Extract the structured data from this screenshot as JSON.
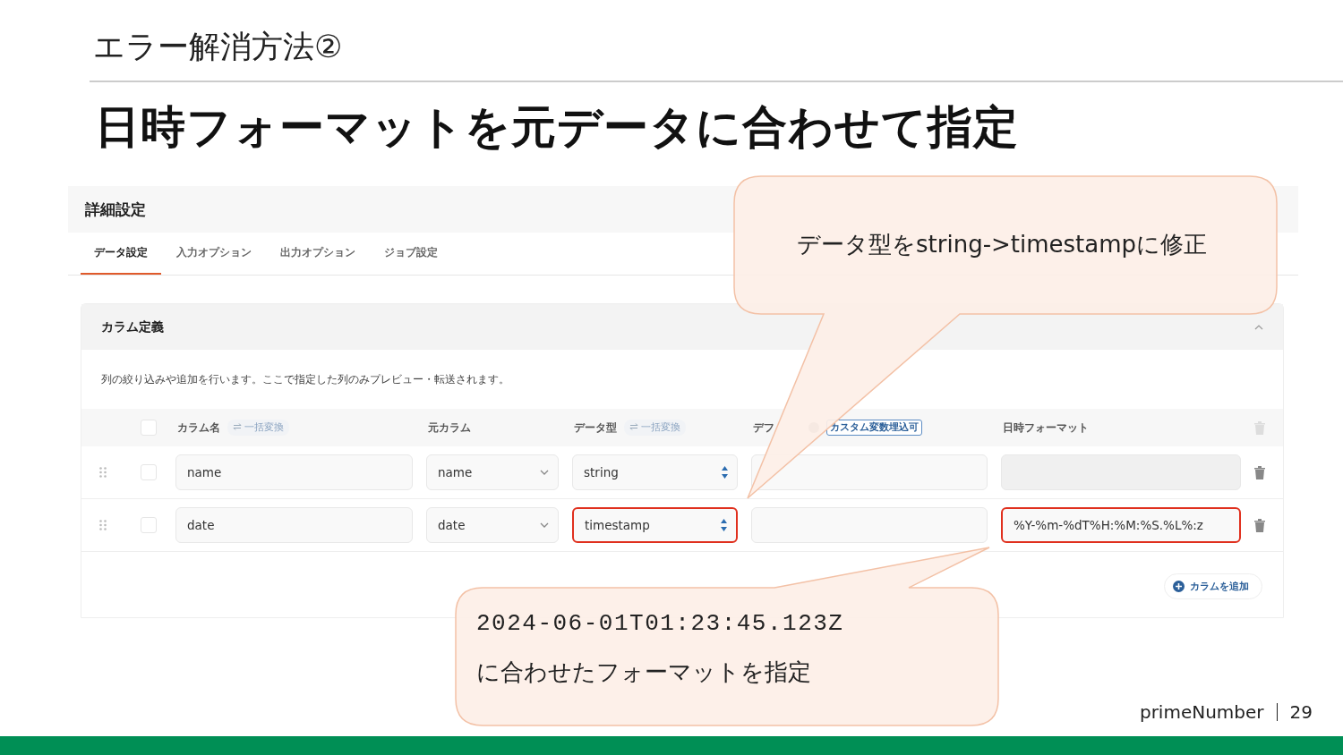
{
  "slide": {
    "section_title": "エラー解消方法②",
    "heading": "日時フォーマットを元データに合わせて指定"
  },
  "app": {
    "panel_title": "詳細設定",
    "tabs": [
      {
        "label": "データ設定",
        "selected": true
      },
      {
        "label": "入力オプション",
        "selected": false
      },
      {
        "label": "出力オプション",
        "selected": false
      },
      {
        "label": "ジョブ設定",
        "selected": false
      }
    ],
    "card": {
      "title": "カラム定義",
      "expanded": true,
      "description": "列の絞り込みや追加を行います。ここで指定した列のみプレビュー・転送されます。",
      "header_checked": false,
      "columns": [
        {
          "label": "カラム名",
          "chip": "一括変換"
        },
        {
          "label": "元カラム"
        },
        {
          "label": "データ型",
          "chip": "一括変換"
        },
        {
          "label": "デフ",
          "help": true,
          "badge": "カスタム変数埋込可"
        },
        {
          "label": "日時フォーマット"
        }
      ],
      "rows": [
        {
          "checked": false,
          "name": "name",
          "source": "name",
          "type": "string",
          "type_highlighted": false,
          "format_disabled": true,
          "format_highlighted": false
        },
        {
          "checked": false,
          "name": "date",
          "source": "date",
          "type": "timestamp",
          "type_highlighted": true,
          "format": "%Y-%m-%dT%H:%M:%S.%L%:z",
          "format_disabled": false,
          "format_highlighted": true
        }
      ],
      "add_button": "カラムを追加"
    }
  },
  "callouts": [
    {
      "lines": [
        {
          "kind": "plain",
          "text": "データ型をstring->timestampに修正"
        }
      ]
    },
    {
      "lines": [
        {
          "kind": "mono",
          "text": "2024-06-01T01:23:45.123Z"
        },
        {
          "kind": "plain",
          "text": "に合わせたフォーマットを指定"
        }
      ]
    }
  ],
  "footer": {
    "brand": "primeNumber",
    "page": "29"
  }
}
